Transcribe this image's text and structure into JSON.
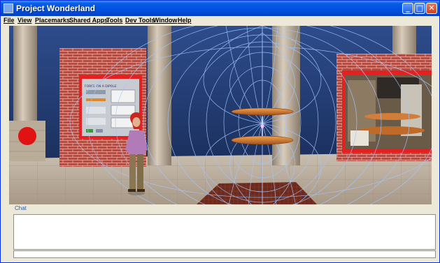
{
  "window": {
    "title": "Project Wonderland",
    "controls": {
      "minimize": "_",
      "maximize": "□",
      "close": "✕"
    }
  },
  "menubar": {
    "items": [
      "File",
      "View",
      "Placemarks",
      "Shared Apps",
      "Tools",
      "Dev Tools",
      "Window",
      "Help"
    ]
  },
  "scene": {
    "panel_title": "FORCE ON A DIPOLE",
    "colors": {
      "sky": "#1e3467",
      "brick": "#b24d43",
      "floor": "#b3a595",
      "field_lines": "#a4c6ff",
      "disk": "#d47a2c"
    }
  },
  "chat": {
    "label": "Chat",
    "message_text": "",
    "input_value": ""
  }
}
